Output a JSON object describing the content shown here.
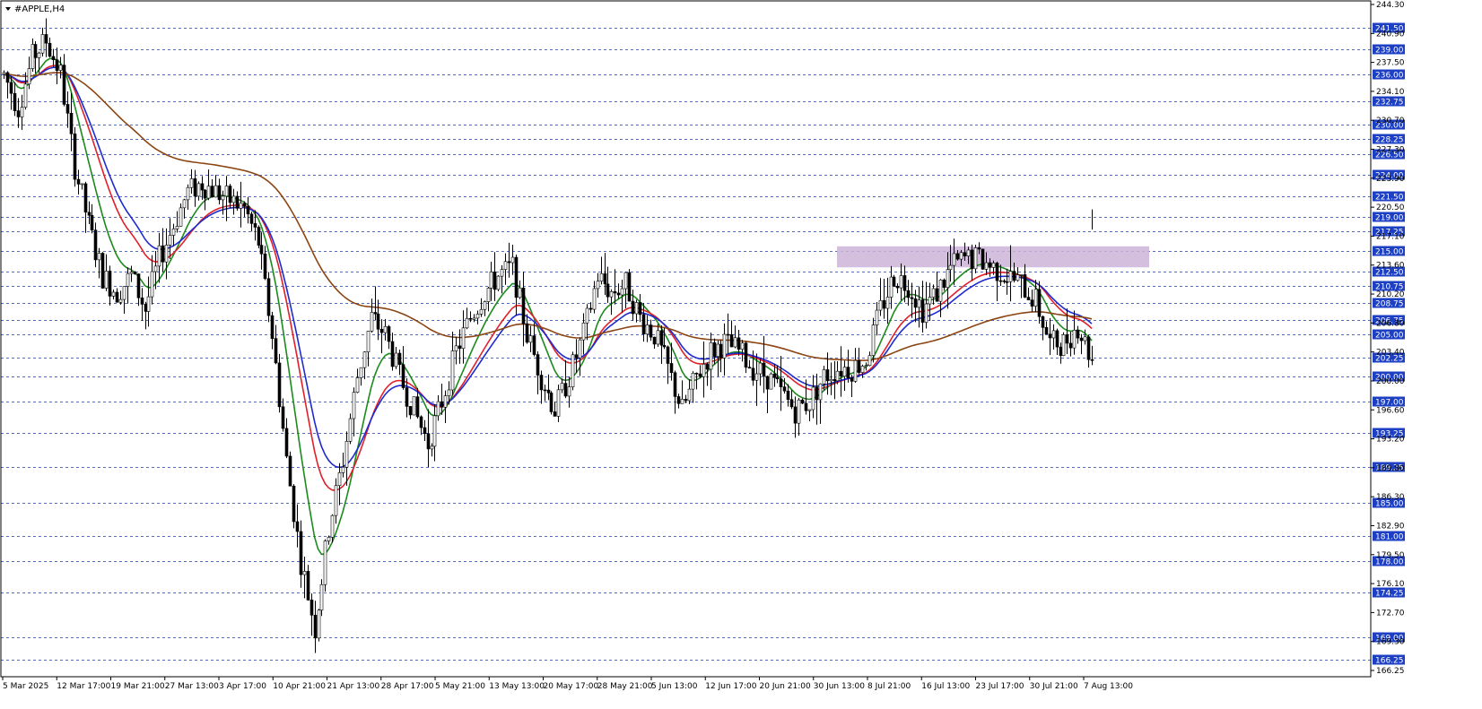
{
  "window": {
    "title": "#APPLE,H4",
    "menu_icon": "triangle-down-icon"
  },
  "colors": {
    "background": "#ffffff",
    "frame": "#000000",
    "grid_line": "#4a6fd0",
    "candle": "#000000",
    "zone_fill": "#cdb4d8",
    "current_price_line": "#000000"
  },
  "chart_data": {
    "type": "candlestick",
    "symbol": "#APPLE",
    "timeframe": "H4",
    "ylim": [
      165.0,
      244.3
    ],
    "price_axis_labels": [
      "244.30",
      "240.90",
      "237.50",
      "234.10",
      "230.70",
      "227.30",
      "223.90",
      "220.50",
      "217.10",
      "213.60",
      "210.20",
      "206.80",
      "203.40",
      "200.00",
      "196.60",
      "193.20",
      "189.80",
      "186.30",
      "182.90",
      "179.50",
      "176.10",
      "172.70",
      "169.30",
      "166.25"
    ],
    "level_lines": [
      241.5,
      239.0,
      236.0,
      232.75,
      230.0,
      228.25,
      226.5,
      224.0,
      221.5,
      219.0,
      217.25,
      215.0,
      212.5,
      210.75,
      208.75,
      206.75,
      205.0,
      202.25,
      200.0,
      197.0,
      193.25,
      189.25,
      185.0,
      181.0,
      178.0,
      174.25,
      169.0,
      166.25
    ],
    "level_labels": [
      "241.50",
      "239.00",
      "236.00",
      "232.75",
      "230.00",
      "228.25",
      "226.50",
      "224.00",
      "221.50",
      "219.00",
      "217.25",
      "215.00",
      "212.50",
      "210.75",
      "208.75",
      "206.75",
      "205.00",
      "202.25",
      "200.00",
      "197.00",
      "193.25",
      "189.25",
      "185.00",
      "181.00",
      "178.00",
      "174.25",
      "169.00",
      "166.25"
    ],
    "current_price": 218.7,
    "current_price_label": "",
    "time_labels": [
      "5 Mar 2025",
      "12 Mar 17:00",
      "19 Mar 21:00",
      "27 Mar 13:00",
      "3 Apr 17:00",
      "10 Apr 21:00",
      "21 Apr 13:00",
      "28 Apr 17:00",
      "5 May 21:00",
      "13 May 13:00",
      "20 May 17:00",
      "28 May 21:00",
      "5 Jun 13:00",
      "12 Jun 17:00",
      "20 Jun 21:00",
      "30 Jun 13:00",
      "8 Jul 21:00",
      "16 Jul 13:00",
      "23 Jul 17:00",
      "30 Jul 21:00",
      "7 Aug 13:00"
    ],
    "resistance_zone": {
      "price_low": 213.0,
      "price_high": 215.5,
      "from_label": "30 Jun 13:00",
      "to_label": "7 Aug 13:00"
    },
    "candle_path": [
      [
        0,
        236
      ],
      [
        4,
        232
      ],
      [
        8,
        238
      ],
      [
        12,
        240
      ],
      [
        16,
        236
      ],
      [
        20,
        225
      ],
      [
        24,
        218
      ],
      [
        28,
        212
      ],
      [
        32,
        210
      ],
      [
        36,
        212
      ],
      [
        40,
        208
      ],
      [
        44,
        214
      ],
      [
        48,
        218
      ],
      [
        52,
        222
      ],
      [
        56,
        223
      ],
      [
        60,
        222
      ],
      [
        64,
        221
      ],
      [
        68,
        220
      ],
      [
        72,
        216
      ],
      [
        76,
        205
      ],
      [
        80,
        190
      ],
      [
        84,
        178
      ],
      [
        88,
        170
      ],
      [
        92,
        182
      ],
      [
        96,
        190
      ],
      [
        100,
        200
      ],
      [
        104,
        207
      ],
      [
        108,
        205
      ],
      [
        112,
        200
      ],
      [
        116,
        196
      ],
      [
        120,
        192
      ],
      [
        124,
        197
      ],
      [
        128,
        203
      ],
      [
        132,
        207
      ],
      [
        136,
        210
      ],
      [
        140,
        212
      ],
      [
        144,
        213
      ],
      [
        148,
        205
      ],
      [
        152,
        200
      ],
      [
        156,
        196
      ],
      [
        160,
        200
      ],
      [
        164,
        205
      ],
      [
        168,
        212
      ],
      [
        172,
        210
      ],
      [
        176,
        211
      ],
      [
        180,
        207
      ],
      [
        184,
        205
      ],
      [
        188,
        201
      ],
      [
        192,
        196
      ],
      [
        196,
        200
      ],
      [
        200,
        203
      ],
      [
        204,
        204
      ],
      [
        208,
        203
      ],
      [
        212,
        201
      ],
      [
        216,
        200
      ],
      [
        220,
        198
      ],
      [
        224,
        196
      ],
      [
        228,
        197
      ],
      [
        232,
        200
      ],
      [
        236,
        201
      ],
      [
        240,
        201
      ],
      [
        244,
        202
      ],
      [
        248,
        208
      ],
      [
        252,
        212
      ],
      [
        256,
        211
      ],
      [
        260,
        208
      ],
      [
        264,
        210
      ],
      [
        268,
        213
      ],
      [
        272,
        214
      ],
      [
        276,
        214
      ],
      [
        280,
        213
      ],
      [
        284,
        212
      ],
      [
        288,
        211
      ],
      [
        292,
        209
      ],
      [
        296,
        204
      ],
      [
        300,
        204
      ],
      [
        304,
        206
      ],
      [
        308,
        202
      ]
    ],
    "series": [
      {
        "name": "",
        "color": "#1c8a1c",
        "period": 10
      },
      {
        "name": "",
        "color": "#e0202a",
        "period": 20
      },
      {
        "name": "",
        "color": "#1f2ad0",
        "period": 25
      },
      {
        "name": "",
        "color": "#8b4513",
        "period": 100
      }
    ]
  }
}
